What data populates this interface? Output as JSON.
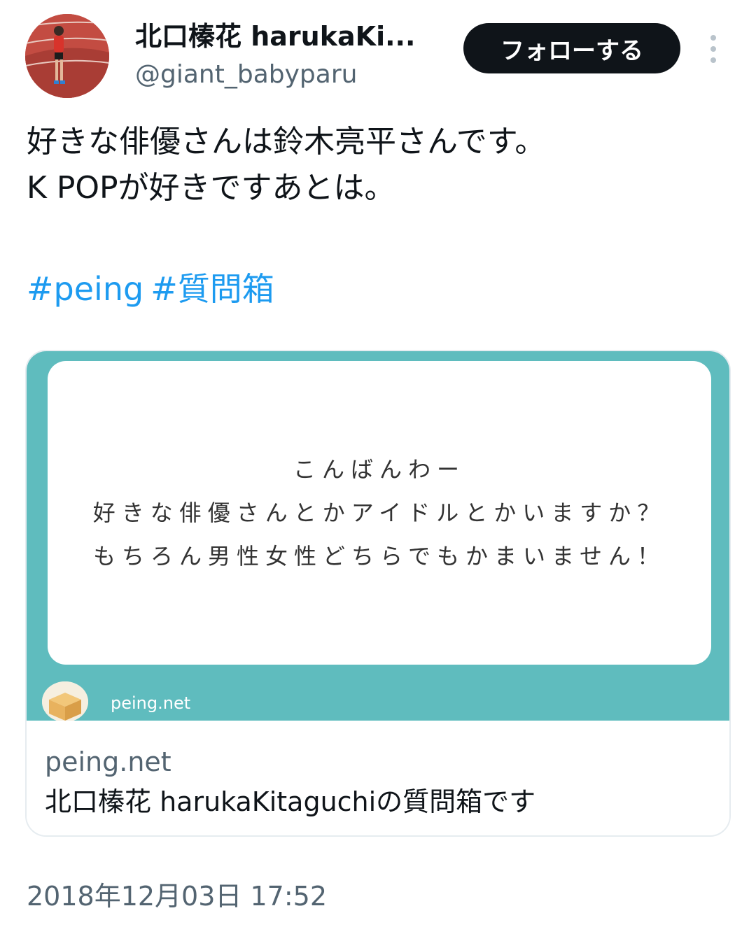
{
  "author": {
    "display_name": "北口榛花 harukaKi...",
    "handle": "@giant_babyparu"
  },
  "follow_button": {
    "label": "フォローする"
  },
  "tweet": {
    "lines": [
      "好きな俳優さんは鈴木亮平さんです。",
      "K POPが好きですあとは。"
    ],
    "hashtags": [
      "#peing",
      "#質問箱"
    ]
  },
  "card": {
    "question_lines": [
      "こんばんわー",
      "好きな俳優さんとかアイドルとかいますか？",
      "もちろん男性女性どちらでもかまいません！"
    ],
    "site_label": "peing.net",
    "domain": "peing.net",
    "title": "北口榛花 harukaKitaguchiの質問箱です"
  },
  "timestamp": "2018年12月03日 17:52",
  "colors": {
    "link": "#1d9bf0",
    "card_background": "#5fbcbe",
    "follow_button": "#0f1419",
    "secondary_text": "#536471"
  }
}
